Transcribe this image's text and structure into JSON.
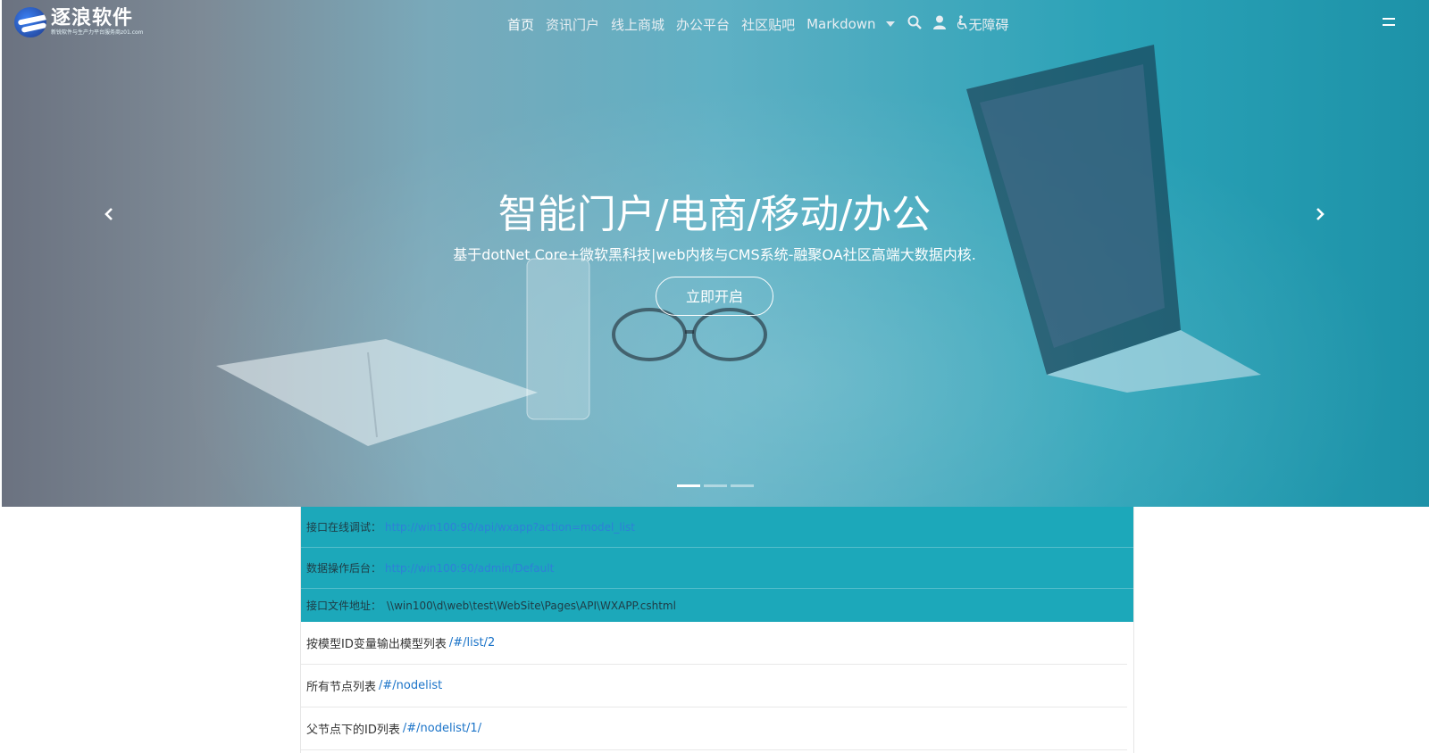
{
  "brand": {
    "name": "逐浪软件",
    "tagline": "新锐软件与生产力平台服务商z01.com"
  },
  "nav": {
    "items": [
      "首页",
      "资讯门户",
      "线上商城",
      "办公平台",
      "社区贴吧",
      "Markdown"
    ],
    "accessibility": "无障碍",
    "icons": [
      "search-icon",
      "user-icon",
      "accessibility-icon",
      "menu-icon"
    ]
  },
  "hero": {
    "title": "智能门户/电商/移动/办公",
    "subtitle": "基于dotNet Core+微软黑科技|web内核与CMS系统-融聚OA社区高端大数据内核.",
    "button": "立即开启",
    "slides_total": 3,
    "active_slide": 1
  },
  "api_info": [
    {
      "label": "接口在线调试：",
      "value": "http://win100:90/api/wxapp?action=model_list",
      "is_link": true
    },
    {
      "label": "数据操作后台：",
      "value": "http://win100:90/admin/Default",
      "is_link": true
    },
    {
      "label": "接口文件地址：",
      "value": "\\\\win100\\d\\web\\test\\WebSite\\Pages\\API\\WXAPP.cshtml",
      "is_link": false
    }
  ],
  "routes": [
    {
      "label": "按模型ID变量输出模型列表",
      "path": "/#/list/2"
    },
    {
      "label": "所有节点列表",
      "path": "/#/nodelist"
    },
    {
      "label": "父节点下的ID列表",
      "path": "/#/nodelist/1/"
    }
  ],
  "colors": {
    "api_bg": "#1ca8ba",
    "link": "#1a73c8",
    "hero_end": "#1d92a8"
  }
}
